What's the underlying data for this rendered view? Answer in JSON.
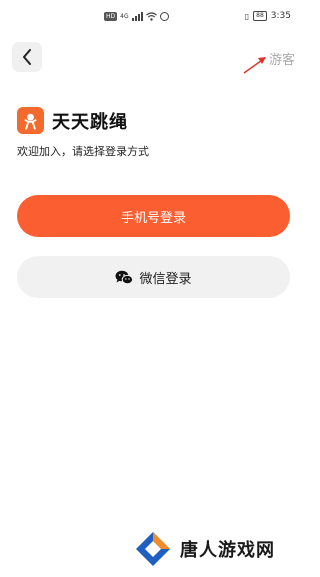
{
  "status_bar": {
    "left_badges": [
      "HD",
      "4G"
    ],
    "time": "3:35",
    "battery": "88"
  },
  "header": {
    "guest_label": "游客"
  },
  "brand": {
    "app_name": "天天跳绳",
    "subtitle": "欢迎加入，请选择登录方式"
  },
  "login": {
    "phone_label": "手机号登录",
    "wechat_label": "微信登录"
  },
  "watermark": {
    "text": "唐人游戏网"
  },
  "colors": {
    "accent": "#fb5e31",
    "logo": "#f26a2e",
    "secondary_button": "#f1f1f1",
    "arrow": "#e0312a"
  }
}
